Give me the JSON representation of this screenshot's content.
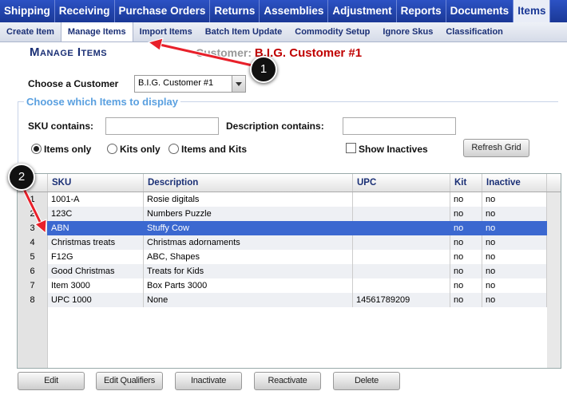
{
  "top_nav": [
    "Shipping",
    "Receiving",
    "Purchase Orders",
    "Returns",
    "Assemblies",
    "Adjustment",
    "Reports",
    "Documents",
    "Items"
  ],
  "sub_nav": [
    "Create Item",
    "Manage Items",
    "Import Items",
    "Batch Item Update",
    "Commodity Setup",
    "Ignore Skus",
    "Classification"
  ],
  "page": {
    "title": "Manage Items",
    "customer_label": "Customer:",
    "customer_name": "B.I.G. Customer #1"
  },
  "form": {
    "choose_customer_label": "Choose a Customer",
    "customer_select_value": "B.I.G. Customer #1",
    "display_legend": "Choose which Items to display",
    "sku_label": "SKU contains:",
    "sku_value": "",
    "desc_label": "Description contains:",
    "desc_value": "",
    "radio_items_only": "Items only",
    "radio_kits_only": "Kits only",
    "radio_items_and_kits": "Items and Kits",
    "selected_radio": "Items only",
    "show_inactives_label": "Show Inactives",
    "refresh_label": "Refresh Grid"
  },
  "grid": {
    "columns": [
      "SKU",
      "Description",
      "UPC",
      "Kit",
      "Inactive"
    ],
    "rows": [
      {
        "num": "1",
        "sku": "1001-A",
        "description": "Rosie digitals",
        "upc": "",
        "kit": "no",
        "inactive": "no"
      },
      {
        "num": "2",
        "sku": "123C",
        "description": "Numbers Puzzle",
        "upc": "",
        "kit": "no",
        "inactive": "no"
      },
      {
        "num": "3",
        "sku": "ABN",
        "description": "Stuffy Cow",
        "upc": "",
        "kit": "no",
        "inactive": "no"
      },
      {
        "num": "4",
        "sku": "Christmas treats",
        "description": "Christmas adornaments",
        "upc": "",
        "kit": "no",
        "inactive": "no"
      },
      {
        "num": "5",
        "sku": "F12G",
        "description": "ABC, Shapes",
        "upc": "",
        "kit": "no",
        "inactive": "no"
      },
      {
        "num": "6",
        "sku": "Good Christmas",
        "description": "Treats for Kids",
        "upc": "",
        "kit": "no",
        "inactive": "no"
      },
      {
        "num": "7",
        "sku": "Item 3000",
        "description": "Box Parts 3000",
        "upc": "",
        "kit": "no",
        "inactive": "no"
      },
      {
        "num": "8",
        "sku": "UPC 1000",
        "description": "None",
        "upc": "14561789209",
        "kit": "no",
        "inactive": "no"
      }
    ],
    "selected_row": "3"
  },
  "actions": [
    "Edit",
    "Edit Qualifiers",
    "Inactivate",
    "Reactivate",
    "Delete"
  ],
  "callouts": [
    "1",
    "2"
  ],
  "colors": {
    "nav_bg": "#1d3ea8",
    "selected_row": "#3b68d0",
    "customer_name": "#c00000",
    "annotation_arrow": "#e8202a"
  }
}
